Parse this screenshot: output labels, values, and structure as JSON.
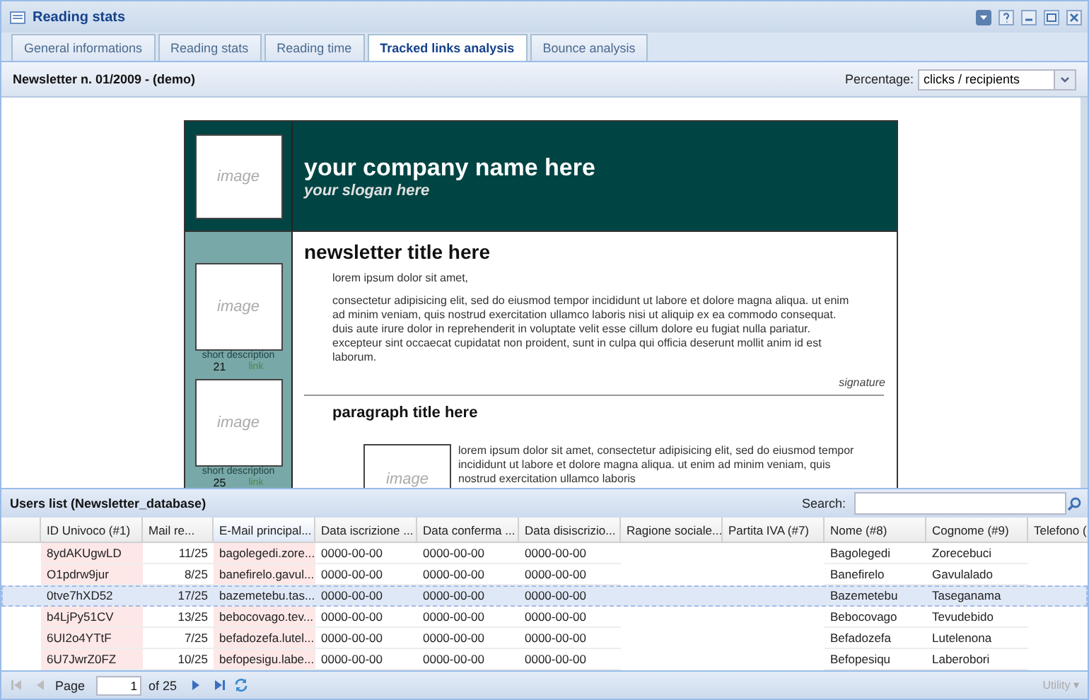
{
  "window": {
    "title": "Reading stats"
  },
  "tabs": [
    {
      "label": "General informations",
      "selected": false
    },
    {
      "label": "Reading stats",
      "selected": false
    },
    {
      "label": "Reading time",
      "selected": false
    },
    {
      "label": "Tracked links analysis",
      "selected": true
    },
    {
      "label": "Bounce analysis",
      "selected": false
    }
  ],
  "toolbar": {
    "title": "Newsletter n. 01/2009 - (demo)",
    "percentage_label": "Percentage:",
    "percentage_value": "clicks / recipients"
  },
  "newsletter": {
    "header_image": "image",
    "company": "your company name here",
    "slogan": "your slogan here",
    "side_items": [
      {
        "image": "image",
        "description": "short description",
        "clicks": "21",
        "link": "link"
      },
      {
        "image": "image",
        "description": "short description",
        "clicks": "25",
        "link": "link"
      }
    ],
    "title": "newsletter title here",
    "greeting": "lorem ipsum dolor sit amet,",
    "body": "consectetur adipisicing elit, sed do eiusmod tempor incididunt ut labore et dolore magna aliqua. ut enim ad minim veniam, quis nostrud exercitation ullamco laboris nisi ut aliquip ex ea commodo consequat. duis aute irure dolor in reprehenderit in voluptate velit esse cillum dolore eu fugiat nulla pariatur. excepteur sint occaecat cupidatat non proident, sunt in culpa qui officia deserunt mollit anim id est laborum.",
    "signature": "signature",
    "paragraph_title": "paragraph title here",
    "paragraph_image": "image",
    "paragraph_body": "lorem ipsum dolor sit amet, consectetur adipisicing elit, sed do eiusmod tempor incididunt ut labore et dolore magna aliqua. ut enim ad minim veniam, quis nostrud exercitation ullamco laboris"
  },
  "users_list": {
    "title": "Users list (Newsletter_database)",
    "search_label": "Search:",
    "columns": [
      {
        "label": "ID Univoco (#1)",
        "sorted": false,
        "highlighted": true
      },
      {
        "label": "Mail re...",
        "sorted": false,
        "highlighted": false
      },
      {
        "label": "E-Mail principal...",
        "sorted": true,
        "highlighted": true
      },
      {
        "label": "Data iscrizione ...",
        "sorted": false,
        "highlighted": false
      },
      {
        "label": "Data conferma ...",
        "sorted": false,
        "highlighted": false
      },
      {
        "label": "Data disiscrizio...",
        "sorted": false,
        "highlighted": false
      },
      {
        "label": "Ragione sociale...",
        "sorted": false,
        "highlighted": false
      },
      {
        "label": "Partita IVA (#7)",
        "sorted": false,
        "highlighted": false
      },
      {
        "label": "Nome (#8)",
        "sorted": false,
        "highlighted": false
      },
      {
        "label": "Cognome (#9)",
        "sorted": false,
        "highlighted": false
      },
      {
        "label": "Telefono (",
        "sorted": false,
        "highlighted": false
      }
    ],
    "rows": [
      {
        "id": "8ydAKUgwLD",
        "mail_received": "11/25",
        "email": "bagolegedi.zore...",
        "subscribed": "0000-00-00",
        "confirmed": "0000-00-00",
        "unsubscribed": "0000-00-00",
        "first_name": "Bagolegedi",
        "last_name": "Zorecebuci",
        "selected": false
      },
      {
        "id": "O1pdrw9jur",
        "mail_received": "8/25",
        "email": "banefirelo.gavul...",
        "subscribed": "0000-00-00",
        "confirmed": "0000-00-00",
        "unsubscribed": "0000-00-00",
        "first_name": "Banefirelo",
        "last_name": "Gavulalado",
        "selected": false
      },
      {
        "id": "0tve7hXD52",
        "mail_received": "17/25",
        "email": "bazemetebu.tas...",
        "subscribed": "0000-00-00",
        "confirmed": "0000-00-00",
        "unsubscribed": "0000-00-00",
        "first_name": "Bazemetebu",
        "last_name": "Taseganama",
        "selected": true
      },
      {
        "id": "b4LjPy51CV",
        "mail_received": "13/25",
        "email": "bebocovago.tev...",
        "subscribed": "0000-00-00",
        "confirmed": "0000-00-00",
        "unsubscribed": "0000-00-00",
        "first_name": "Bebocovago",
        "last_name": "Tevudebido",
        "selected": false
      },
      {
        "id": "6UI2o4YTtF",
        "mail_received": "7/25",
        "email": "befadozefa.lutel...",
        "subscribed": "0000-00-00",
        "confirmed": "0000-00-00",
        "unsubscribed": "0000-00-00",
        "first_name": "Befadozefa",
        "last_name": "Lutelenona",
        "selected": false
      },
      {
        "id": "6U7JwrZ0FZ",
        "mail_received": "10/25",
        "email": "befopesigu.labe...",
        "subscribed": "0000-00-00",
        "confirmed": "0000-00-00",
        "unsubscribed": "0000-00-00",
        "first_name": "Befopesiqu",
        "last_name": "Laberobori",
        "selected": false
      }
    ],
    "paging": {
      "page_label": "Page",
      "page": "1",
      "of_label": "of 25"
    },
    "utility": "Utility ▾"
  }
}
